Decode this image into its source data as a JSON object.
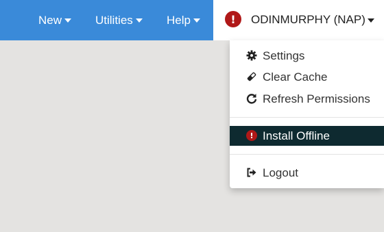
{
  "navbar": {
    "items": [
      {
        "label": "New"
      },
      {
        "label": "Utilities"
      },
      {
        "label": "Help"
      }
    ],
    "user": {
      "label": "ODINMURPHY (NAP)",
      "alert_icon": "!"
    }
  },
  "dropdown": {
    "items": [
      {
        "label": "Settings",
        "icon": "gear-icon"
      },
      {
        "label": "Clear Cache",
        "icon": "eraser-icon"
      },
      {
        "label": "Refresh Permissions",
        "icon": "refresh-icon"
      },
      {
        "label": "Install Offline",
        "icon": "exclamation-circle-icon",
        "alert_icon": "!",
        "active": true
      },
      {
        "label": "Logout",
        "icon": "logout-icon"
      }
    ]
  },
  "colors": {
    "navbar_bg": "#3a8ad9",
    "page_bg": "#e4e3e1",
    "active_item_bg": "#0e2a30",
    "alert_red": "#b01818"
  }
}
